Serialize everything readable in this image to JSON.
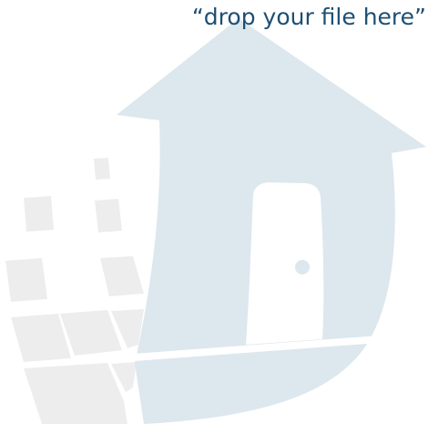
{
  "drop_area": {
    "hint_text": "“drop your file here”",
    "illustration": "house-drop-icon"
  },
  "colors": {
    "hint_text": "#1d4f73",
    "house_fill": "#dde7ee",
    "tiles_fill": "#ededed",
    "background": "#ffffff"
  }
}
